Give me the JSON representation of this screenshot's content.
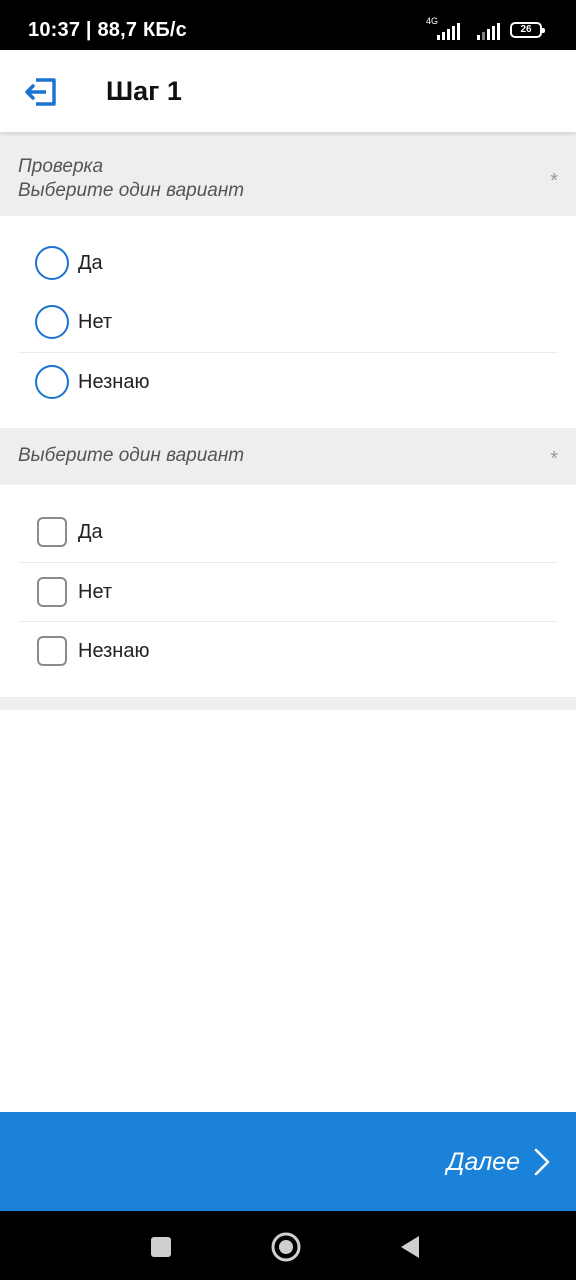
{
  "status_bar": {
    "time": "10:37 | 88,7 КБ/с",
    "network_label": "4G",
    "battery_level": "26"
  },
  "app_bar": {
    "title": "Шаг 1",
    "exit_icon": "exit-icon"
  },
  "questions": [
    {
      "title": "Проверка",
      "hint": "Выберите один вариант",
      "required_mark": "*",
      "type": "radio",
      "options": [
        "Да",
        "Нет",
        "Незнаю"
      ]
    },
    {
      "title": "",
      "hint": "Выберите один вариант",
      "required_mark": "*",
      "type": "checkbox",
      "options": [
        "Да",
        "Нет",
        "Незнаю"
      ]
    }
  ],
  "footer": {
    "next_label": "Далее"
  },
  "colors": {
    "accent": "#1a82d9",
    "radio": "#1a73d1",
    "header_bg": "#eeeeee"
  }
}
